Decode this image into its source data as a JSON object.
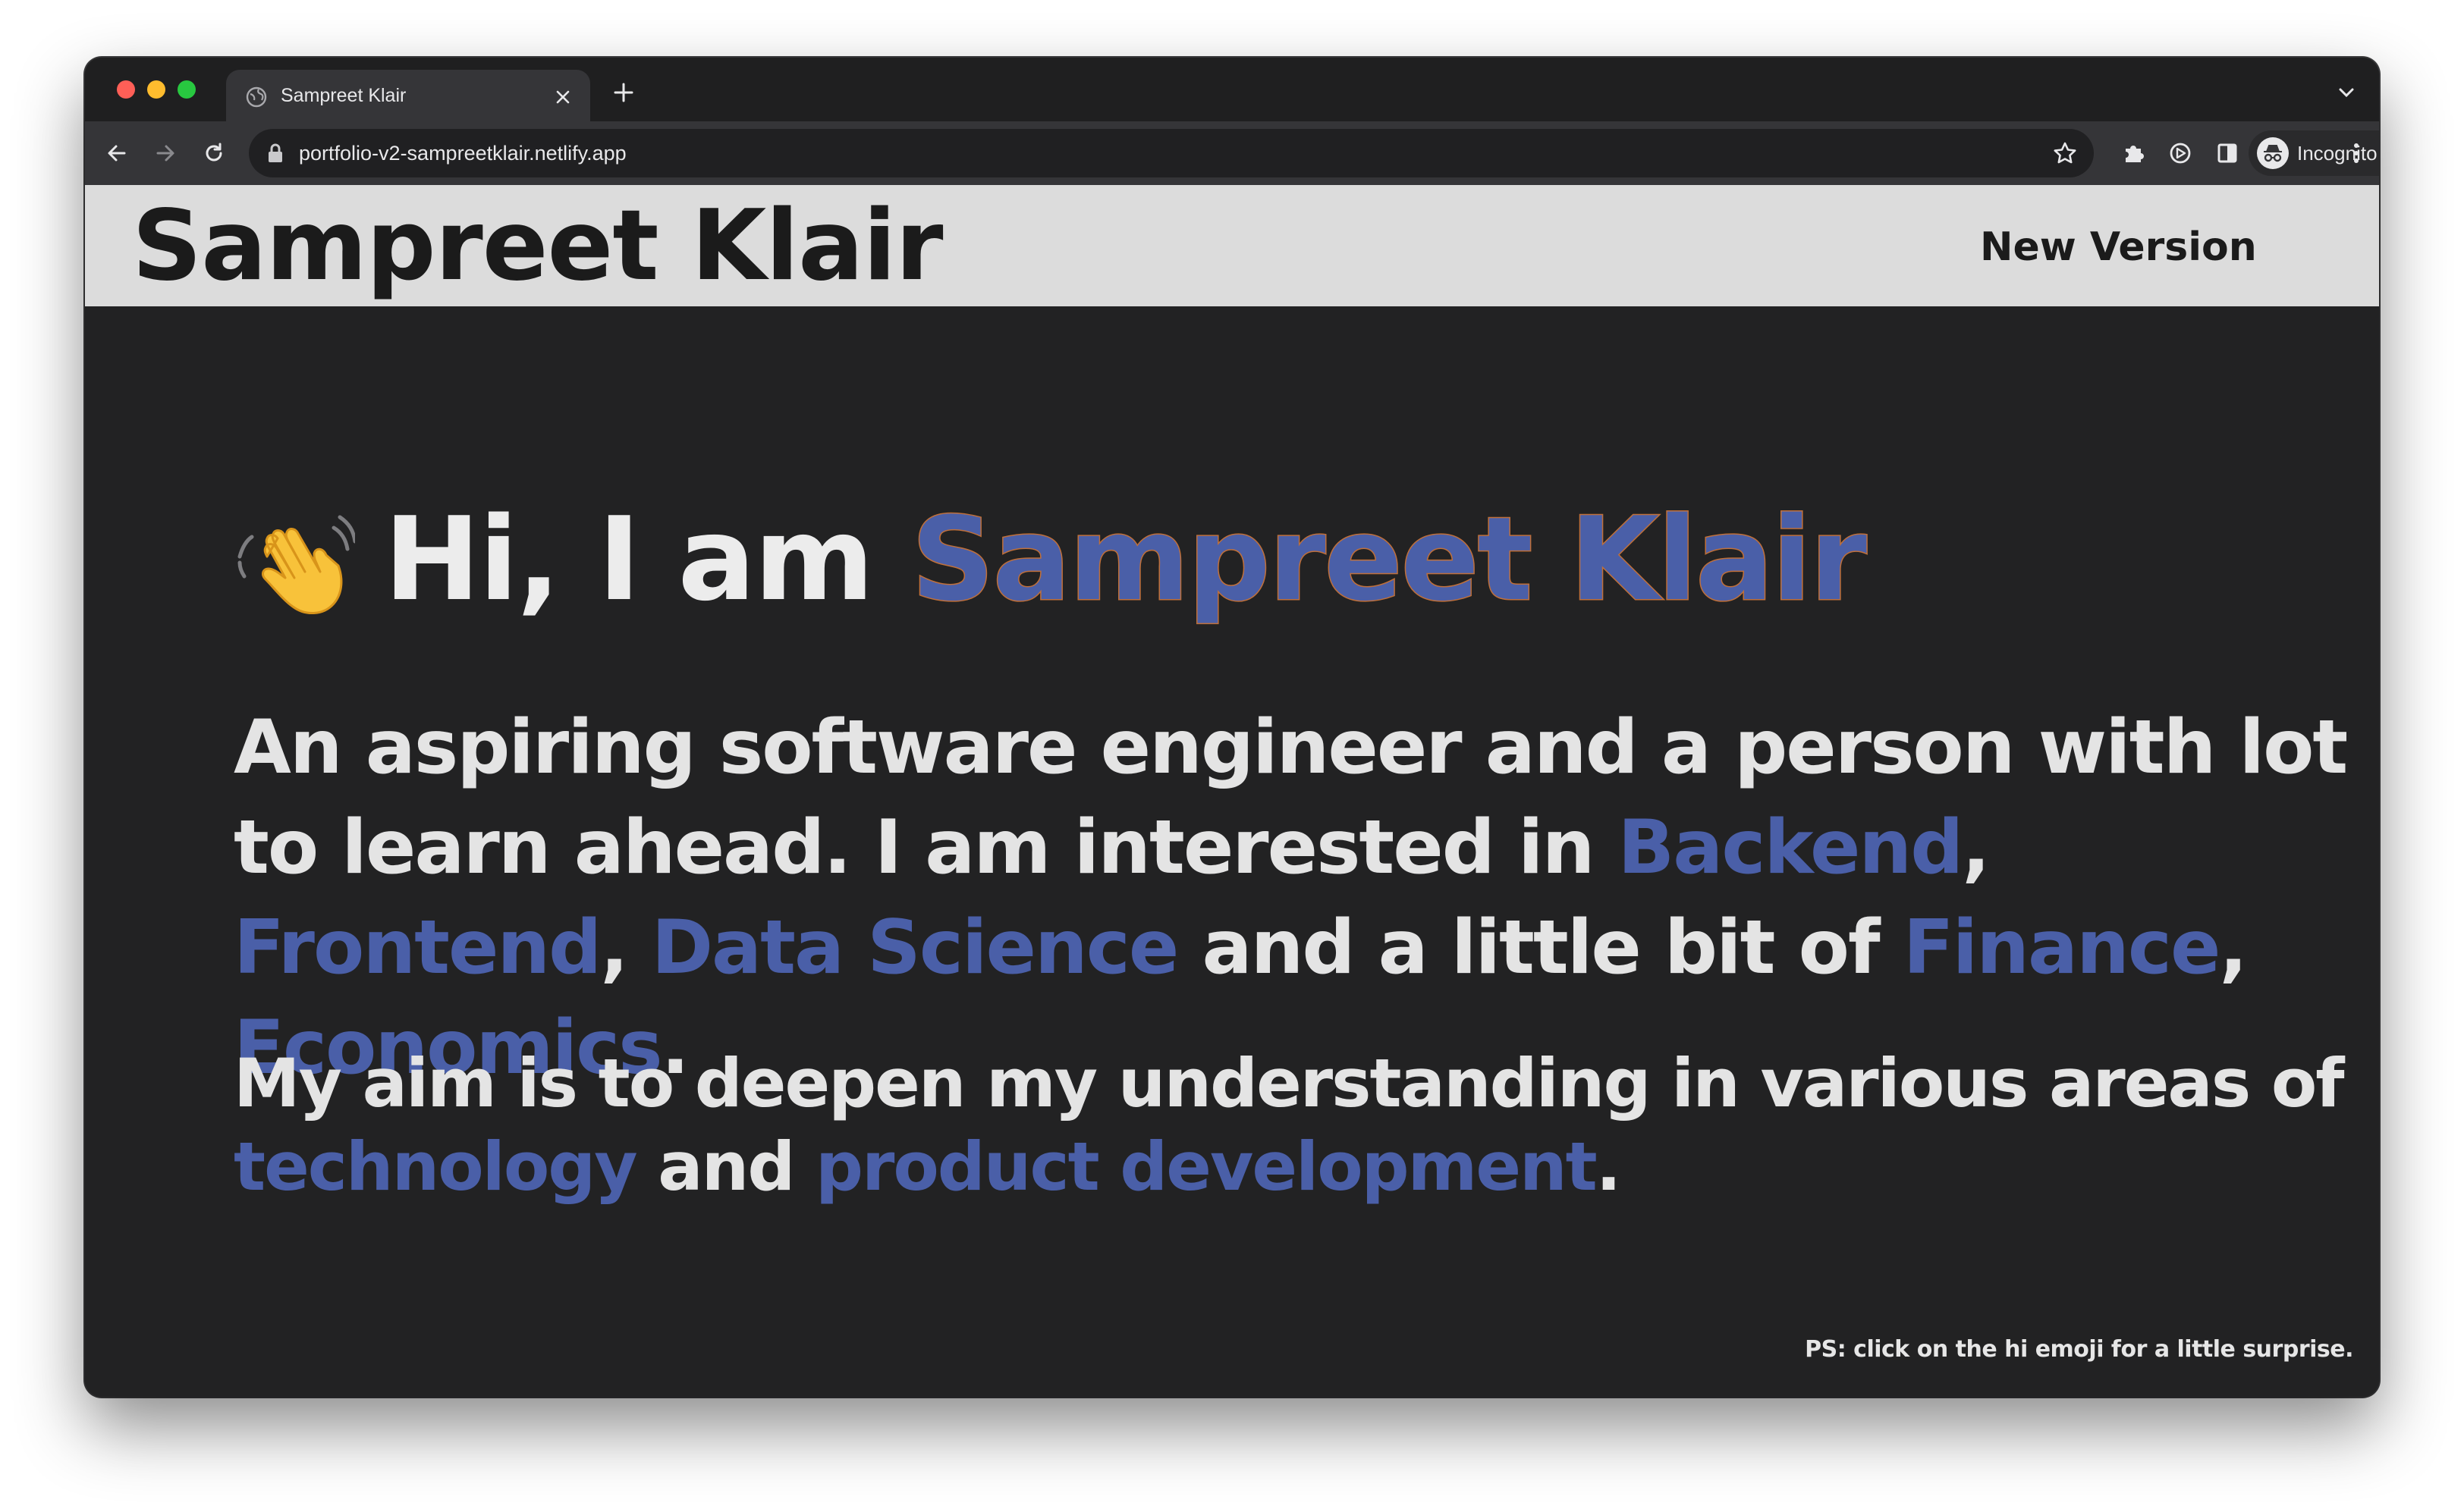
{
  "browser": {
    "tab_title": "Sampreet Klair",
    "url": "portfolio-v2-sampreetklair.netlify.app",
    "profile_label": "Incognito",
    "icons": {
      "favicon": "globe-icon",
      "tab_close": "close-icon",
      "new_tab": "plus-icon",
      "tab_menu": "chevron-down-icon",
      "back": "arrow-left-icon",
      "forward": "arrow-right-icon",
      "reload": "reload-icon",
      "lock": "lock-icon",
      "bookmark": "star-icon",
      "extensions": "puzzle-icon",
      "media": "media-icon",
      "side_panel": "side-panel-icon",
      "profile": "incognito-icon",
      "menu": "kebab-menu-icon"
    }
  },
  "site": {
    "logo": "Sampreet Klair",
    "nav_link": "New Version"
  },
  "hero": {
    "emoji": "👋",
    "greeting": "Hi, I am ",
    "name": "Sampreet Klair"
  },
  "intro": {
    "t1": "An aspiring software engineer and a person with lot to learn ahead. I am interested in ",
    "backend": "Backend",
    "c1": ", ",
    "frontend": "Frontend",
    "c2": ", ",
    "data_science": "Data Science",
    "t2": " and a little bit of ",
    "finance": "Finance",
    "c3": ", ",
    "economics": "Economics",
    "end": "."
  },
  "aim": {
    "t1": "My aim is to deepen my understanding in various areas of ",
    "technology": "technology",
    "t2": " and ",
    "product_development": "product development",
    "end": "."
  },
  "footer_note": "PS: click on the hi emoji for a little surprise.",
  "colors": {
    "accent": "#4a5fa8",
    "name_outline": "#c0703a",
    "page_bg": "#222223",
    "header_bg": "#dcdcdc",
    "text": "#e4e4e4"
  }
}
